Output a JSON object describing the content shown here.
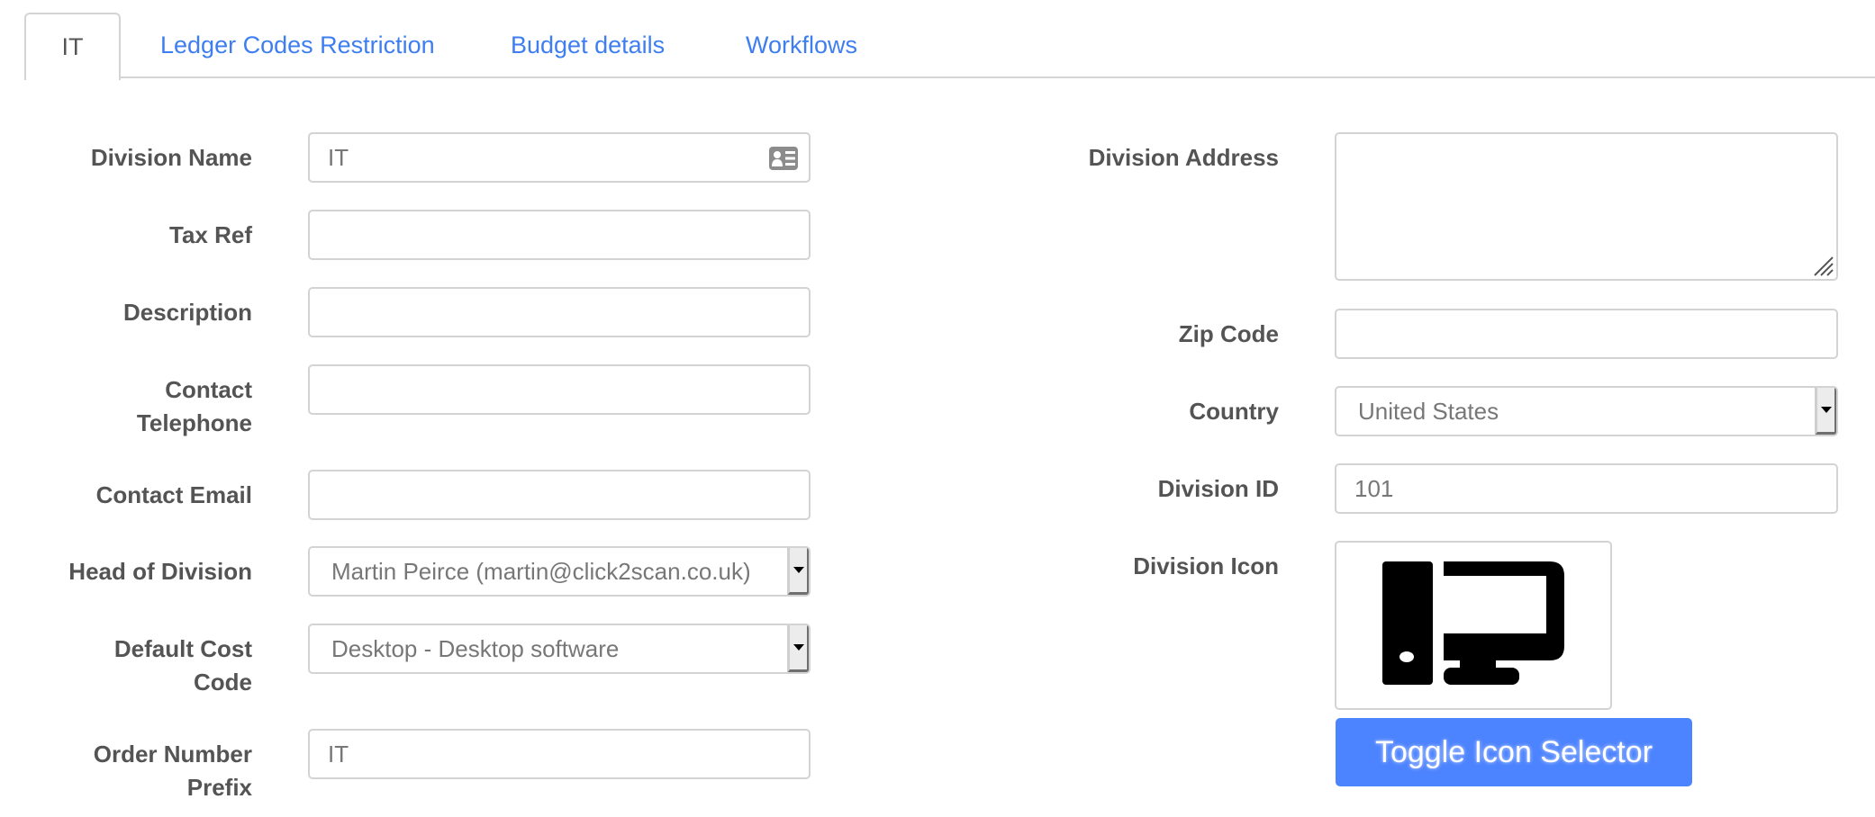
{
  "tabs": [
    {
      "label": "IT",
      "active": true
    },
    {
      "label": "Ledger Codes Restriction",
      "active": false
    },
    {
      "label": "Budget details",
      "active": false
    },
    {
      "label": "Workflows",
      "active": false
    }
  ],
  "form": {
    "division_name": {
      "label": "Division Name",
      "value": "IT",
      "icon": "contact-card-icon"
    },
    "tax_ref": {
      "label": "Tax Ref",
      "value": ""
    },
    "description": {
      "label": "Description",
      "value": ""
    },
    "contact_telephone": {
      "label_line1": "Contact",
      "label_line2": "Telephone",
      "value": ""
    },
    "contact_email": {
      "label": "Contact Email",
      "value": ""
    },
    "head_of_division": {
      "label": "Head of Division",
      "selected": "Martin Peirce (martin@click2scan.co.uk)"
    },
    "default_cost_code": {
      "label_line1": "Default Cost",
      "label_line2": "Code",
      "selected": "Desktop - Desktop software"
    },
    "order_number_prefix": {
      "label_line1": "Order Number",
      "label_line2": "Prefix",
      "value": "IT"
    },
    "division_address": {
      "label": "Division Address",
      "value": ""
    },
    "zip_code": {
      "label": "Zip Code",
      "value": ""
    },
    "country": {
      "label": "Country",
      "selected": "United States"
    },
    "division_id": {
      "label": "Division ID",
      "value": "101"
    },
    "division_icon": {
      "label": "Division Icon",
      "icon": "desktop-computer-icon"
    }
  },
  "buttons": {
    "toggle_icon_selector": "Toggle Icon Selector"
  },
  "colors": {
    "link": "#3e7ef0",
    "button": "#4c83ff",
    "label": "#545454",
    "border": "#d3d3d3"
  }
}
